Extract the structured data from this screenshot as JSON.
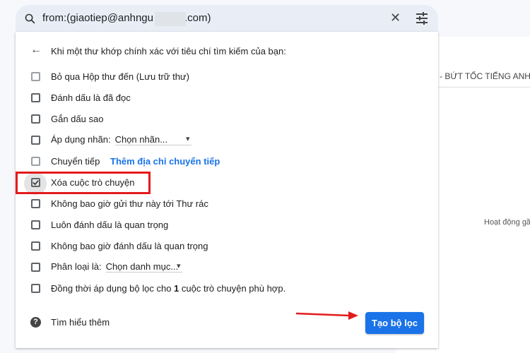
{
  "search": {
    "query": "from:(giaotiep@anhngu",
    "query_suffix": ".com)"
  },
  "background": {
    "subject": "- BỨT TỐC TIẾNG ANH C",
    "activity": "Hoạt động gần"
  },
  "panel": {
    "header": "Khi một thư khớp chính xác với tiêu chí tìm kiếm của bạn:",
    "options": [
      {
        "label": "Bỏ qua Hộp thư đến (Lưu trữ thư)",
        "checked": false
      },
      {
        "label": "Đánh dấu là đã đọc",
        "checked": false
      },
      {
        "label": "Gắn dấu sao",
        "checked": false
      },
      {
        "label": "Áp dụng nhãn:",
        "checked": false,
        "select": "Chọn nhãn..."
      },
      {
        "label": "Chuyển tiếp",
        "checked": false,
        "link": "Thêm địa chỉ chuyển tiếp"
      },
      {
        "label": "Xóa cuộc trò chuyện",
        "checked": true
      },
      {
        "label": "Không bao giờ gửi thư này tới Thư rác",
        "checked": false
      },
      {
        "label": "Luôn đánh dấu là quan trọng",
        "checked": false
      },
      {
        "label": "Không bao giờ đánh dấu là quan trọng",
        "checked": false
      },
      {
        "label": "Phân loại là:",
        "checked": false,
        "select": "Chọn danh mục..."
      }
    ],
    "also_apply": {
      "pre": "Đồng thời áp dụng bộ lọc cho ",
      "count": "1",
      "post": " cuộc trò chuyện phù hợp."
    },
    "learn_more": "Tìm hiểu thêm",
    "create_button": "Tạo bộ lọc"
  },
  "colors": {
    "accent": "#1a73e8",
    "annotation": "#e41b1b"
  }
}
